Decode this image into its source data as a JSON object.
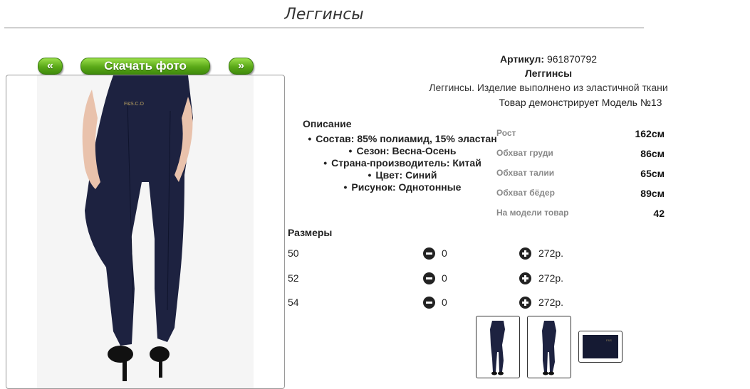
{
  "page": {
    "title": "Леггинсы"
  },
  "gallery": {
    "prev_label": "«",
    "download_label": "Скачать фото",
    "next_label": "»"
  },
  "product": {
    "article_label": "Артикул:",
    "article_value": "961870792",
    "name": "Леггинсы",
    "description": "Леггинсы. Изделие выполнено из эластичной ткани",
    "model_note": "Товар демонстрирует Модель №13"
  },
  "details": {
    "heading": "Описание",
    "items": [
      "Состав: 85% полиамид, 15% эластан",
      "Сезон: Весна-Осень",
      "Страна-производитель: Китай",
      "Цвет: Синий",
      "Рисунок: Однотонные"
    ]
  },
  "measurements": [
    {
      "label": "Рост",
      "value": "162см"
    },
    {
      "label": "Обхват груди",
      "value": "86см"
    },
    {
      "label": "Обхват талии",
      "value": "65см"
    },
    {
      "label": "Обхват бёдер",
      "value": "89см"
    },
    {
      "label": "На модели товар",
      "value": "42"
    }
  ],
  "sizes": {
    "heading": "Размеры",
    "rows": [
      {
        "size": "50",
        "qty": "0",
        "price": "272р."
      },
      {
        "size": "52",
        "qty": "0",
        "price": "272р."
      },
      {
        "size": "54",
        "qty": "0",
        "price": "272р."
      }
    ]
  },
  "colors": {
    "button_green": "#5aa818",
    "product_navy": "#1d2240"
  },
  "icons": {
    "minus": "minus-circle-icon",
    "plus": "plus-circle-icon"
  }
}
